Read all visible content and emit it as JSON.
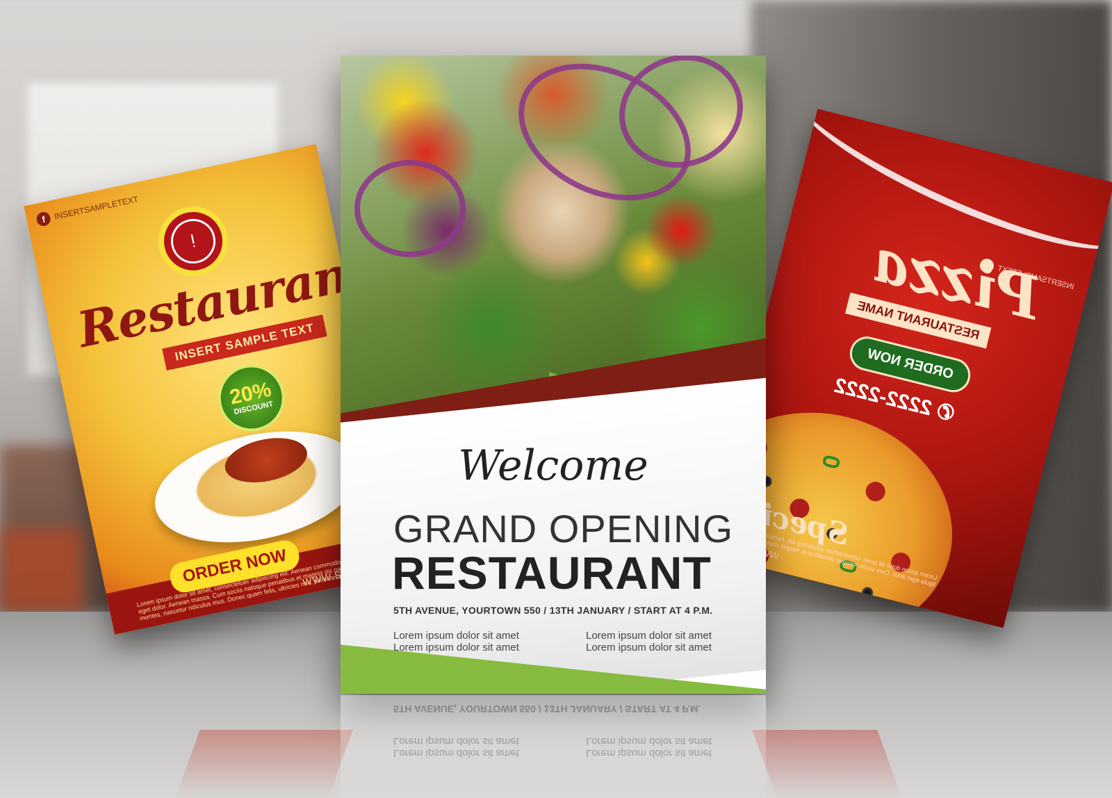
{
  "left_flyer": {
    "social_handle": "INSERTSAMPLETEXT",
    "facebook_glyph": "f",
    "title": "Restaurant",
    "ribbon": "INSERT SAMPLE TEXT",
    "discount_percent": "20%",
    "discount_label": "DISCOUNT",
    "order_button": "ORDER NOW",
    "lorem": "Lorem ipsum dolor sit amet, consectetuer adipiscing elit. Aenean commodo ligula eget dolor. Aenean massa. Cum sociis natoque penatibus et magnis dis parturient montes, nascetur ridiculus mus. Donec quam felis, ultricies nec, pellentesque eu,",
    "website": "WWW.SAM",
    "colors": {
      "primary": "#b3141a",
      "accent": "#ffe02a"
    }
  },
  "center_flyer": {
    "welcome": "Welcome",
    "headline": "GRAND OPENING",
    "subheadline": "RESTAURANT",
    "details": "5TH AVENUE, YOURTOWN 550  / 13TH JANUARY / START AT 4 P.M.",
    "lorem_left_1": "Lorem ipsum dolor sit amet",
    "lorem_left_2": "Lorem ipsum dolor sit amet",
    "lorem_right_1": "Lorem ipsum dolor sit amet",
    "lorem_right_2": "Lorem ipsum dolor sit amet",
    "colors": {
      "band": "#7f1e14",
      "accent": "#87bb3f"
    }
  },
  "right_flyer": {
    "social_handle": "INSERTSAMPLETEXT",
    "facebook_glyph": "f",
    "title": "Pizza",
    "restaurant_name": "RESTAURANT NAME",
    "order_button": "ORDER NOW",
    "phone": "✆ 2222-2222",
    "special": "Special",
    "lorem": "Lorem ipsum dolor sit amet, consectetuer adipiscing elit. Aenean commodo ligula eget dolor. Cum sociis natoque penatibus et magnis massa.",
    "website": "WWW.RES",
    "colors": {
      "primary": "#a9150f",
      "accent": "#1f6b1f"
    }
  },
  "reflection": {
    "details": "5TH AVENUE, YOURTOWN 550  / 13TH JANUARY / START AT 4 P.M."
  }
}
